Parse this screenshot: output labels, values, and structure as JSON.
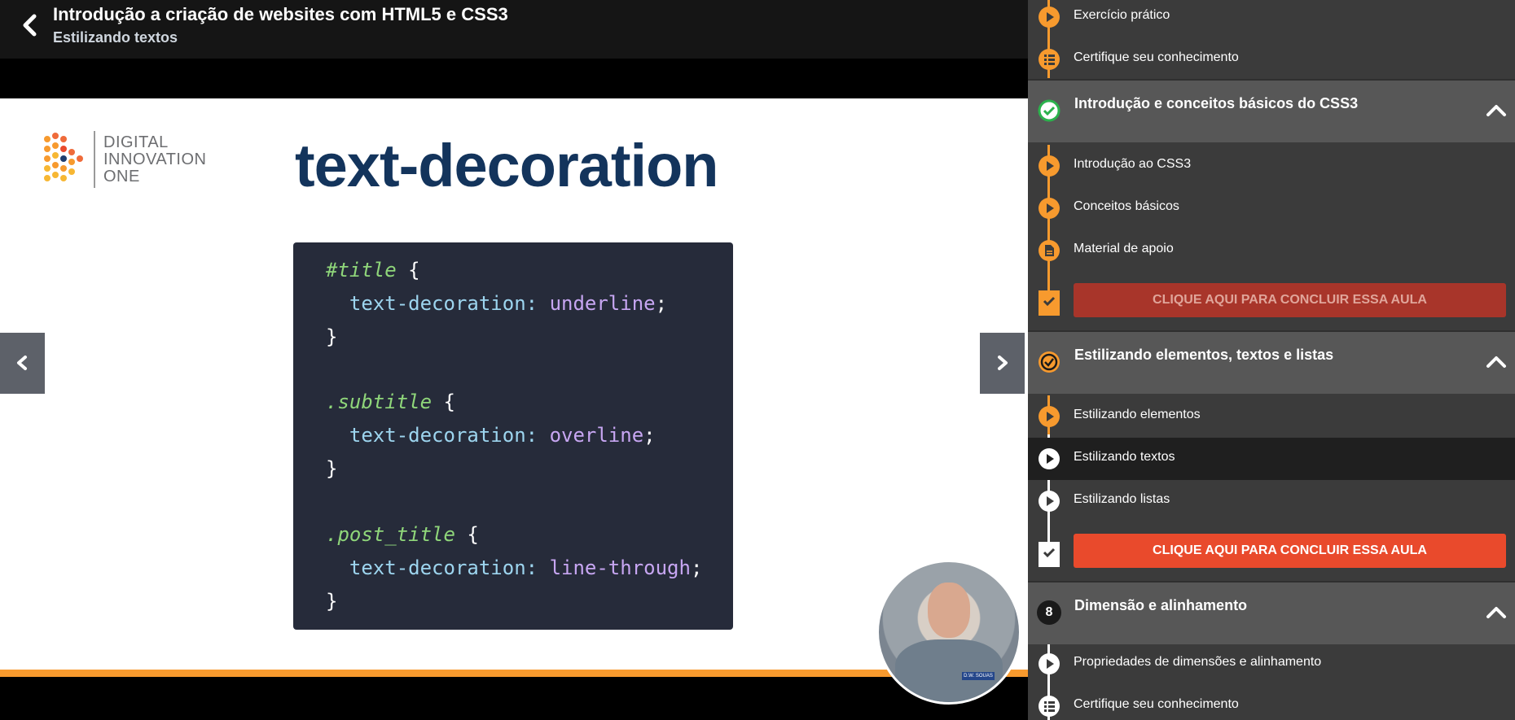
{
  "header": {
    "course_title": "Introdução a criação de websites com HTML5 e CSS3",
    "lesson_subtitle": "Estilizando textos"
  },
  "slide": {
    "logo_lines": [
      "DIGITAL",
      "INNOVATION",
      "ONE"
    ],
    "title": "text-decoration",
    "code": [
      {
        "sel": "#title",
        "rest": " {"
      },
      {
        "prop": "text-decoration",
        "colon": ": ",
        "val": "underline",
        "end": ";"
      },
      {
        "plain": "}"
      },
      {
        "sel": ".subtitle",
        "rest": " {"
      },
      {
        "prop": "text-decoration",
        "colon": ": ",
        "val": "overline",
        "end": ";"
      },
      {
        "plain": "}"
      },
      {
        "sel": ".post_title",
        "rest": " {"
      },
      {
        "prop": "text-decoration",
        "colon": ": ",
        "val": "line-through",
        "end": ";"
      },
      {
        "plain": "}"
      }
    ],
    "webcam_badge": "D.W. SOUAS"
  },
  "sidebar": {
    "top_items": [
      "Exercício prático",
      "Certifique seu conhecimento"
    ],
    "sections": [
      {
        "title": "Introdução e conceitos básicos do CSS3",
        "items": [
          "Introdução ao CSS3",
          "Conceitos básicos",
          "Material de apoio"
        ],
        "cta": "CLIQUE AQUI PARA CONCLUIR ESSA AULA"
      },
      {
        "title": "Estilizando elementos, textos e listas",
        "items": [
          "Estilizando elementos",
          "Estilizando textos",
          "Estilizando listas"
        ],
        "cta": "CLIQUE AQUI PARA CONCLUIR ESSA AULA"
      },
      {
        "number": "8",
        "title": "Dimensão e alinhamento",
        "items": [
          "Propriedades de dimensões e alinhamento",
          "Certifique seu conhecimento"
        ]
      }
    ]
  },
  "colors": {
    "accent_orange": "#f79a2e",
    "cta_red": "#e94a2c",
    "slide_title": "#13345c",
    "complete_green": "#2bb24c"
  }
}
